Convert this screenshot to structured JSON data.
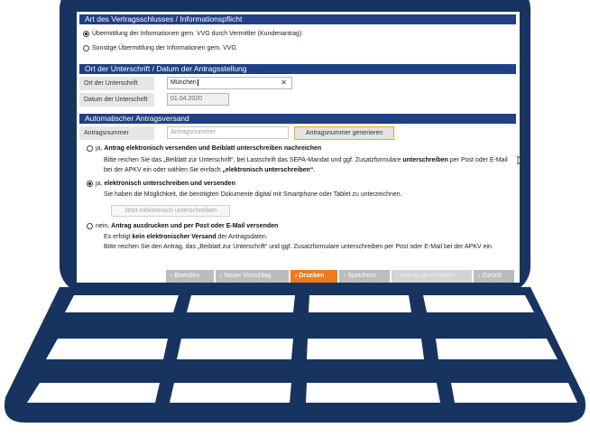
{
  "section1": {
    "header": "Art des Vertragsschlusses / Informationspflicht",
    "option1": "Übermittlung der Informationen gem. VVG durch Vermittler (Kundenantrag)",
    "option2": "Sonstige Übermittlung der Informationen gem. VVG"
  },
  "section2": {
    "header": "Ort der Unterschrift / Datum der Antragsstellung",
    "place_label": "Ort der Unterschrift",
    "place_value": "München",
    "date_label": "Datum der Unterschrift",
    "date_value": "01.04.2020"
  },
  "section3": {
    "header": "Automatischer Antragsversand",
    "number_label": "Antragsnummer",
    "number_placeholder": "Antragsnummer",
    "generate_button": "Antragsnummer generieren",
    "opt1": {
      "prefix": "ja, ",
      "title": "Antrag elektronisch versenden und Beiblatt unterschreiben nachreichen",
      "text_a": "Bitte reichen Sie das „Beiblatt zur Unterschrift“, bei Lastschrift das SEPA-Mandat und ggf. Zusatzformulare ",
      "text_b": "unterschreiben",
      "text_c": " per Post oder E-Mail bei der APKV ein oder wählen Sie einfach ",
      "text_d": "„elektronisch unterschreiben“",
      "text_e": "."
    },
    "opt2": {
      "prefix": "ja, ",
      "title": "elektronisch unterschreiben und versenden",
      "text": "Sie haben die Möglichkeit, die benötigten Dokumente digital mit Smartphone oder Tablet zu unterzeichnen.",
      "button": "Jetzt elektronisch unterschreiben"
    },
    "opt3": {
      "prefix": "nein, ",
      "title": "Antrag ausdrucken und per Post oder E-Mail versenden",
      "text_a": "Es erfolgt ",
      "text_b": "kein elektronischer Versand",
      "text_c": " der Antragsdaten.",
      "text_d": "Bitte reichen Sie den Antrag, das „Beiblatt zur Unterschrift“ und ggf. Zusatzformulare unterschreiben per Post oder E-Mail bei der APKV ein."
    }
  },
  "toolbar": {
    "chevron": "›",
    "beenden": "Beenden",
    "neuer_vorschlag": "Neuer Vorschlag",
    "drucken": "Drucken",
    "speichern": "Speichern",
    "antrag_abschliessen": "Antrag abschließen",
    "zurueck": "Zurück"
  },
  "colors": {
    "laptop": "#173460",
    "header": "#1f3f86",
    "accent_orange": "#f07b1e"
  }
}
